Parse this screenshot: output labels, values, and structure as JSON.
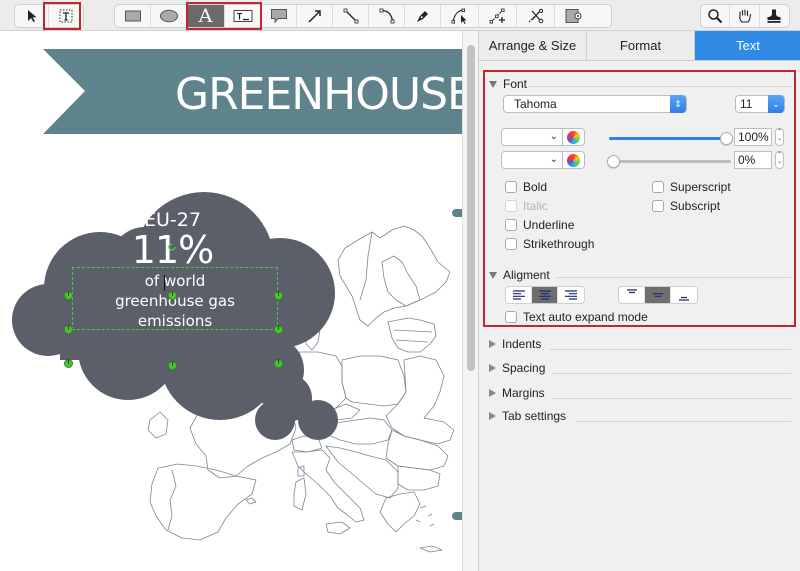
{
  "toolbar": {
    "groups": [
      {
        "tools": [
          {
            "name": "select-tool",
            "icon": "arrow-pointer-icon"
          },
          {
            "name": "text-box-select-tool",
            "icon": "text-frame-icon",
            "highlighted": true
          }
        ]
      },
      {
        "tools": [
          {
            "name": "rectangle-tool",
            "icon": "rectangle-icon"
          },
          {
            "name": "ellipse-tool",
            "icon": "ellipse-icon"
          },
          {
            "name": "text-tool",
            "icon": "letter-a-icon",
            "active": true,
            "glyph": "A"
          },
          {
            "name": "text-block-tool",
            "icon": "text-block-icon"
          },
          {
            "name": "callout-tool",
            "icon": "speech-bubble-icon"
          },
          {
            "name": "arrow-tool",
            "icon": "arrow-line-icon"
          },
          {
            "name": "line-tool",
            "icon": "line-icon"
          },
          {
            "name": "arc-tool",
            "icon": "arc-icon"
          },
          {
            "name": "pen-tool",
            "icon": "pen-nib-icon"
          },
          {
            "name": "bezier-tool",
            "icon": "bezier-icon"
          },
          {
            "name": "add-point-tool",
            "icon": "add-point-icon"
          },
          {
            "name": "cut-path-tool",
            "icon": "scissors-icon"
          },
          {
            "name": "container-tool",
            "icon": "container-icon"
          }
        ]
      },
      {
        "tools": [
          {
            "name": "zoom-tool",
            "icon": "magnifier-icon"
          },
          {
            "name": "hand-tool",
            "icon": "hand-icon"
          },
          {
            "name": "stamp-tool",
            "icon": "stamp-icon"
          }
        ]
      }
    ]
  },
  "canvas": {
    "banner_title": "GREENHOUSE",
    "cloud": {
      "line1": "EU-27",
      "line2": "11%",
      "line3a": "of world",
      "line3b": "greenhouse gas",
      "line3c": "emissions"
    },
    "colors": {
      "banner": "#5f838c",
      "cloud": "#5b5f69",
      "map_stroke": "#7b8597",
      "selection": "#4cc93a",
      "highlight": "#c0282d"
    }
  },
  "panel": {
    "tabs": [
      {
        "label": "Arrange & Size",
        "active": false
      },
      {
        "label": "Format",
        "active": false
      },
      {
        "label": "Text",
        "active": true
      }
    ],
    "font": {
      "header": "Font",
      "family": "Tahoma",
      "size": "11",
      "opacity1": "100%",
      "opacity1_value": 1.0,
      "opacity2": "0%",
      "opacity2_value": 0.0,
      "checkboxes_left": [
        {
          "label": "Bold",
          "checked": false,
          "disabled": false
        },
        {
          "label": "Italic",
          "checked": false,
          "disabled": true
        },
        {
          "label": "Underline",
          "checked": false,
          "disabled": false
        },
        {
          "label": "Strikethrough",
          "checked": false,
          "disabled": false
        }
      ],
      "checkboxes_right": [
        {
          "label": "Superscript",
          "checked": false
        },
        {
          "label": "Subscript",
          "checked": false
        }
      ]
    },
    "alignment": {
      "header": "Aligment",
      "horizontal": [
        "align-left",
        "align-center",
        "align-right"
      ],
      "horizontal_selected": "align-center",
      "vertical": [
        "align-top",
        "align-middle",
        "align-bottom"
      ],
      "vertical_selected": "align-middle",
      "auto_expand_label": "Text auto expand mode",
      "auto_expand_checked": false
    },
    "collapsed_sections": [
      {
        "label": "Indents"
      },
      {
        "label": "Spacing"
      },
      {
        "label": "Margins"
      },
      {
        "label": "Tab settings"
      }
    ]
  }
}
